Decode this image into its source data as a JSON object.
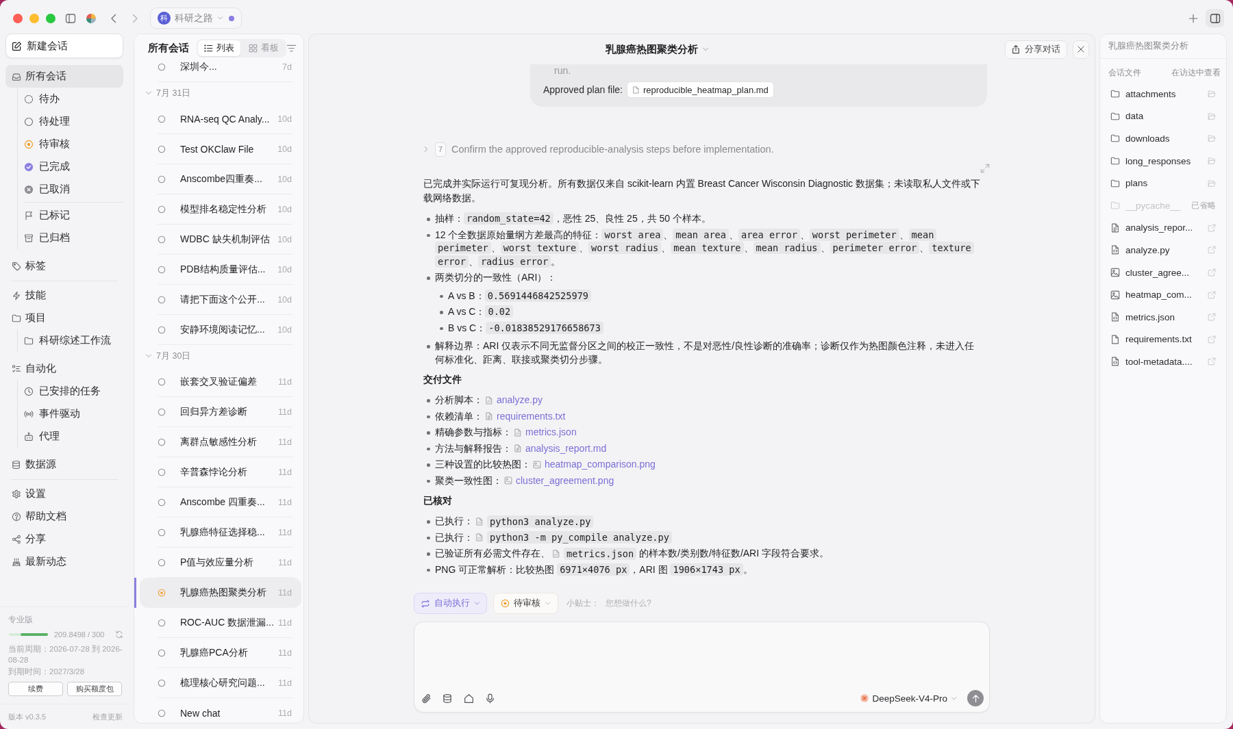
{
  "titlebar": {
    "workspace": {
      "initial": "科",
      "name": "科研之路",
      "indicator": true
    }
  },
  "sidebar": {
    "new_chat": "新建会话",
    "sections": [
      [
        {
          "label": "所有会话",
          "selected": true,
          "children": [
            [
              {
                "label": "待办",
                "selected": false
              },
              {
                "label": "待处理",
                "selected": false
              },
              {
                "label": "待审核",
                "selected": false
              },
              {
                "label": "已完成",
                "selected": false
              },
              {
                "label": "已取消",
                "selected": false
              }
            ],
            [
              {
                "label": "已标记",
                "selected": false
              },
              {
                "label": "已归档",
                "selected": false
              }
            ]
          ]
        },
        {
          "label": "标签",
          "selected": false
        }
      ],
      [
        {
          "label": "技能",
          "selected": false
        },
        {
          "label": "项目",
          "selected": false,
          "children": [
            [
              {
                "label": "科研综述工作流",
                "selected": false
              }
            ]
          ]
        },
        {
          "label": "自动化",
          "selected": false,
          "children": [
            [
              {
                "label": "已安排的任务",
                "selected": false
              },
              {
                "label": "事件驱动",
                "selected": false
              },
              {
                "label": "代理",
                "selected": false
              }
            ]
          ]
        },
        {
          "label": "数据源",
          "selected": false
        }
      ],
      [
        {
          "label": "设置",
          "selected": false
        },
        {
          "label": "帮助文档",
          "selected": false
        },
        {
          "label": "分享",
          "selected": false
        },
        {
          "label": "最新动态",
          "selected": false
        }
      ]
    ],
    "plan": {
      "name": "专业版",
      "level": 0.7,
      "usage": "209.8498 / 300",
      "period": "当前周期：2026-07-28 到 2026-08-28",
      "expiry": "到期时间：2027/3/28",
      "buttons": [
        "续费",
        "购买额度包"
      ]
    },
    "version": "版本 v0.3.5",
    "check_update": "检查更新"
  },
  "conversations": {
    "title": "所有会话",
    "views": [
      {
        "label": "列表",
        "selected": true
      },
      {
        "label": "看板",
        "selected": false
      }
    ],
    "items": [
      {
        "title": "深圳今...",
        "age": "7d",
        "in_review": false,
        "selected": false
      }
    ],
    "groups": [
      {
        "label": "7月 31日",
        "expanded": true,
        "items": [
          {
            "title": "RNA-seq QC Analy...",
            "age": "10d",
            "in_review": false,
            "selected": false
          },
          {
            "title": "Test OKClaw File",
            "age": "10d",
            "in_review": false,
            "selected": false
          },
          {
            "title": "Anscombe四重奏...",
            "age": "10d",
            "in_review": false,
            "selected": false
          },
          {
            "title": "模型排名稳定性分析",
            "age": "10d",
            "in_review": false,
            "selected": false
          },
          {
            "title": "WDBC 缺失机制评估",
            "age": "10d",
            "in_review": false,
            "selected": false
          },
          {
            "title": "PDB结构质量评估...",
            "age": "10d",
            "in_review": false,
            "selected": false
          },
          {
            "title": "请把下面这个公开...",
            "age": "10d",
            "in_review": false,
            "selected": false
          },
          {
            "title": "安静环境阅读记忆...",
            "age": "10d",
            "in_review": false,
            "selected": false
          }
        ]
      },
      {
        "label": "7月 30日",
        "expanded": true,
        "items": [
          {
            "title": "嵌套交叉验证偏差",
            "age": "11d",
            "in_review": false,
            "selected": false
          },
          {
            "title": "回归异方差诊断",
            "age": "11d",
            "in_review": false,
            "selected": false
          },
          {
            "title": "离群点敏感性分析",
            "age": "11d",
            "in_review": false,
            "selected": false
          },
          {
            "title": "辛普森悖论分析",
            "age": "11d",
            "in_review": false,
            "selected": false
          },
          {
            "title": "Anscombe 四重奏...",
            "age": "11d",
            "in_review": false,
            "selected": false
          },
          {
            "title": "乳腺癌特征选择稳...",
            "age": "11d",
            "in_review": false,
            "selected": false
          },
          {
            "title": "P值与效应量分析",
            "age": "11d",
            "in_review": false,
            "selected": false
          },
          {
            "title": "乳腺癌热图聚类分析",
            "age": "11d",
            "in_review": true,
            "selected": true
          },
          {
            "title": "ROC-AUC 数据泄漏...",
            "age": "11d",
            "in_review": false,
            "selected": false
          },
          {
            "title": "乳腺癌PCA分析",
            "age": "11d",
            "in_review": false,
            "selected": false
          },
          {
            "title": "梳理核心研究问题...",
            "age": "11d",
            "in_review": false,
            "selected": false
          },
          {
            "title": "New chat",
            "age": "11d",
            "in_review": false,
            "selected": false
          }
        ]
      }
    ]
  },
  "chat": {
    "title": "乳腺癌热图聚类分析",
    "share": "分享对话",
    "plan_card": {
      "fragment": "run.",
      "label": "Approved plan file:",
      "file": "reproducible_heatmap_plan.md"
    },
    "step": {
      "number": "7",
      "text": "Confirm the approved reproducible-analysis steps before implementation.",
      "expanded": false
    },
    "message": {
      "blocks": [
        {
          "kind": "paragraph",
          "text": "已完成并实际运行可复现分析。所有数据仅来自 scikit-learn 内置 Breast Cancer Wisconsin Diagnostic 数据集；未读取私人文件或下载网络数据。"
        },
        {
          "kind": "list",
          "items": [
            {
              "parts": [
                {
                  "kind": "text",
                  "text": "抽样："
                },
                {
                  "kind": "code",
                  "text": "random_state=42"
                },
                {
                  "kind": "text",
                  "text": "，恶性 25、良性 25，共 50 个样本。"
                }
              ]
            },
            {
              "parts": [
                {
                  "kind": "text",
                  "text": "12 个全数据原始量纲方差最高的特征："
                },
                {
                  "kind": "code",
                  "text": "worst area"
                },
                {
                  "kind": "text",
                  "text": "、"
                },
                {
                  "kind": "code",
                  "text": "mean area"
                },
                {
                  "kind": "text",
                  "text": "、"
                },
                {
                  "kind": "code",
                  "text": "area error"
                },
                {
                  "kind": "text",
                  "text": "、"
                },
                {
                  "kind": "code",
                  "text": "worst perimeter"
                },
                {
                  "kind": "text",
                  "text": "、"
                },
                {
                  "kind": "code",
                  "text": "mean perimeter"
                },
                {
                  "kind": "text",
                  "text": "、"
                },
                {
                  "kind": "code",
                  "text": "worst texture"
                },
                {
                  "kind": "text",
                  "text": "、"
                },
                {
                  "kind": "code",
                  "text": "worst radius"
                },
                {
                  "kind": "text",
                  "text": "、"
                },
                {
                  "kind": "code",
                  "text": "mean texture"
                },
                {
                  "kind": "text",
                  "text": "、"
                },
                {
                  "kind": "code",
                  "text": "mean radius"
                },
                {
                  "kind": "text",
                  "text": "、"
                },
                {
                  "kind": "code",
                  "text": "perimeter error"
                },
                {
                  "kind": "text",
                  "text": "、"
                },
                {
                  "kind": "code",
                  "text": "texture error"
                },
                {
                  "kind": "text",
                  "text": "、"
                },
                {
                  "kind": "code",
                  "text": "radius error"
                },
                {
                  "kind": "text",
                  "text": "。"
                }
              ]
            },
            {
              "parts": [
                {
                  "kind": "text",
                  "text": "两类切分的一致性（ARI）："
                }
              ],
              "children": [
                {
                  "parts": [
                    {
                      "kind": "text",
                      "text": "A vs B："
                    },
                    {
                      "kind": "code",
                      "text": "0.5691446842525979"
                    }
                  ]
                },
                {
                  "parts": [
                    {
                      "kind": "text",
                      "text": "A vs C："
                    },
                    {
                      "kind": "code",
                      "text": "0.02"
                    }
                  ]
                },
                {
                  "parts": [
                    {
                      "kind": "text",
                      "text": "B vs C："
                    },
                    {
                      "kind": "code",
                      "text": "-0.01838529176658673"
                    }
                  ]
                }
              ]
            },
            {
              "parts": [
                {
                  "kind": "text",
                  "text": "解释边界：ARI 仅表示不同无监督分区之间的校正一致性，不是对恶性/良性诊断的准确率；诊断仅作为热图颜色注释，未进入任何标准化、距离、联接或聚类切分步骤。"
                }
              ]
            }
          ]
        },
        {
          "kind": "heading",
          "text": "交付文件"
        },
        {
          "kind": "list",
          "items": [
            {
              "parts": [
                {
                  "kind": "text",
                  "text": "分析脚本："
                },
                {
                  "kind": "code_file_link",
                  "text": "analyze.py"
                }
              ]
            },
            {
              "parts": [
                {
                  "kind": "text",
                  "text": "依赖清单："
                },
                {
                  "kind": "document_link",
                  "text": "requirements.txt"
                }
              ]
            },
            {
              "parts": [
                {
                  "kind": "text",
                  "text": "精确参数与指标："
                },
                {
                  "kind": "code_file_link",
                  "text": "metrics.json"
                }
              ]
            },
            {
              "parts": [
                {
                  "kind": "text",
                  "text": "方法与解释报告："
                },
                {
                  "kind": "document_link",
                  "text": "analysis_report.md"
                }
              ]
            },
            {
              "parts": [
                {
                  "kind": "text",
                  "text": "三种设置的比较热图："
                },
                {
                  "kind": "image_link",
                  "text": "heatmap_comparison.png"
                }
              ]
            },
            {
              "parts": [
                {
                  "kind": "text",
                  "text": "聚类一致性图："
                },
                {
                  "kind": "image_link",
                  "text": "cluster_agreement.png"
                }
              ]
            }
          ]
        },
        {
          "kind": "heading",
          "text": "已核对"
        },
        {
          "kind": "list",
          "items": [
            {
              "parts": [
                {
                  "kind": "text",
                  "text": "已执行："
                },
                {
                  "kind": "code_file_ref",
                  "text": "python3 analyze.py"
                }
              ]
            },
            {
              "parts": [
                {
                  "kind": "text",
                  "text": "已执行："
                },
                {
                  "kind": "code_file_ref",
                  "text": "python3 -m py_compile analyze.py"
                }
              ]
            },
            {
              "parts": [
                {
                  "kind": "text",
                  "text": "已验证所有必需文件存在、"
                },
                {
                  "kind": "code_file_ref",
                  "text": "metrics.json"
                },
                {
                  "kind": "text",
                  "text": " 的样本数/类别数/特征数/ARI 字段符合要求。"
                }
              ]
            },
            {
              "parts": [
                {
                  "kind": "text",
                  "text": "PNG 可正常解析：比较热图 "
                },
                {
                  "kind": "code",
                  "text": "6971×4076 px"
                },
                {
                  "kind": "text",
                  "text": "，ARI 图 "
                },
                {
                  "kind": "code",
                  "text": "1906×1743 px"
                },
                {
                  "kind": "text",
                  "text": "。"
                }
              ]
            }
          ]
        }
      ]
    },
    "composer": {
      "mode": "自动执行",
      "status_filter": "待审核",
      "tip_label": "小贴士：",
      "tip": "您想做什么?",
      "model": "DeepSeek-V4-Pro"
    }
  },
  "files_panel": {
    "title": "乳腺癌热图聚类分析",
    "section": "会话文件",
    "reveal": "在访达中查看",
    "items": [
      {
        "name": "attachments",
        "kind": "folder",
        "omitted": false
      },
      {
        "name": "data",
        "kind": "folder",
        "omitted": false
      },
      {
        "name": "downloads",
        "kind": "folder",
        "omitted": false
      },
      {
        "name": "long_responses",
        "kind": "folder",
        "omitted": false
      },
      {
        "name": "plans",
        "kind": "folder",
        "omitted": false
      },
      {
        "name": "__pycache__",
        "kind": "folder",
        "omitted": true,
        "note": "已省略"
      },
      {
        "name": "analysis_repor...",
        "kind": "document",
        "omitted": false
      },
      {
        "name": "analyze.py",
        "kind": "code",
        "omitted": false
      },
      {
        "name": "cluster_agree...",
        "kind": "image",
        "omitted": false
      },
      {
        "name": "heatmap_com...",
        "kind": "image",
        "omitted": false
      },
      {
        "name": "metrics.json",
        "kind": "code",
        "omitted": false
      },
      {
        "name": "requirements.txt",
        "kind": "file",
        "omitted": false
      },
      {
        "name": "tool-metadata....",
        "kind": "code",
        "omitted": false
      }
    ]
  }
}
